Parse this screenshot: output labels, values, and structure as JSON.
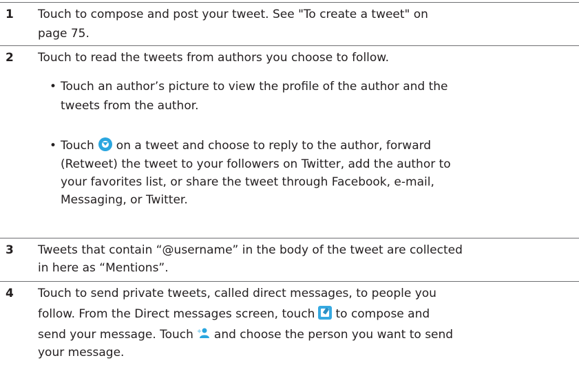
{
  "rows": [
    {
      "number": "1",
      "line1": "Touch to compose and post your tweet. See \"To create a tweet\" on",
      "line2": "page 75."
    },
    {
      "number": "2",
      "line1": "Touch to read the tweets from authors you choose to follow.",
      "bullet1_line1": "Touch an author’s picture to view the profile of the author and the",
      "bullet1_line2": "tweets from the author.",
      "bullet2_before_icon": "Touch",
      "bullet2_after_icon": "on a tweet and choose to reply to the author, forward",
      "bullet2_line2": "(Retweet) the tweet to your followers on Twitter, add the author to",
      "bullet2_line3": "your favorites list, or share the tweet through Facebook, e-mail,",
      "bullet2_line4": "Messaging, or Twitter."
    },
    {
      "number": "3",
      "line1": "Tweets that contain “@username” in the body of the tweet are collected",
      "line2": "in here as “Mentions”."
    },
    {
      "number": "4",
      "line1": "Touch to send private tweets, called direct messages, to people you",
      "line2_before_icon": "follow. From the Direct messages screen, touch",
      "line2_after_icon": "to compose and",
      "line3_before_icon": "send your message. Touch",
      "line3_after_icon": "and choose the person you want to send",
      "line4": "your message."
    }
  ],
  "icons": {
    "options": "chevron-down-circle-icon",
    "compose": "compose-message-icon",
    "person": "add-person-icon"
  },
  "colors": {
    "accent": "#2aa6df",
    "text": "#231f20",
    "rule": "#6d6e71"
  }
}
